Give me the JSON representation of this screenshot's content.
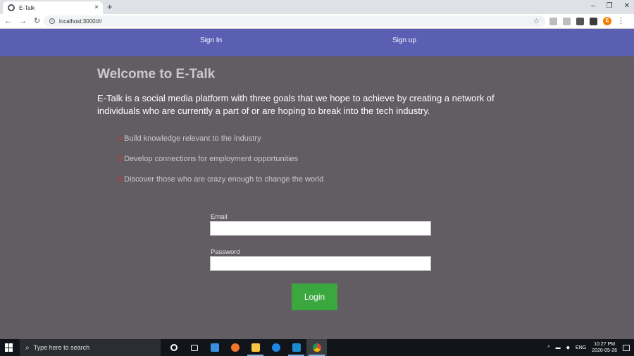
{
  "browser": {
    "tab_title": "E-Talk",
    "tab_close": "×",
    "new_tab": "+",
    "url": "localhost:3000/#/",
    "win_minimize": "–",
    "win_restore": "❐",
    "win_close": "✕",
    "profile_initial": "E"
  },
  "nav": {
    "signin": "Sign In",
    "signup": "Sign up",
    "bg_color": "#5b5fb4"
  },
  "main": {
    "title": "Welcome to E-Talk",
    "intro": "E-Talk is a social media platform with three goals that we hope to achieve by creating a network of individuals who are currently a part of or are hoping to break into the tech industry.",
    "goals": [
      {
        "num": "1",
        "text": "Build knowledge relevant to the industry"
      },
      {
        "num": "2",
        "text": "Develop connections for employment opportunities"
      },
      {
        "num": "3",
        "text": "Discover those who are crazy enough to change the world"
      }
    ]
  },
  "form": {
    "email_label": "Email",
    "email_value": "",
    "password_label": "Password",
    "password_value": "",
    "login_label": "Login",
    "login_color": "#3aa83f"
  },
  "taskbar": {
    "search_placeholder": "Type here to search",
    "lang": "ENG",
    "time": "10:27 PM",
    "date": "2020-05-26"
  }
}
